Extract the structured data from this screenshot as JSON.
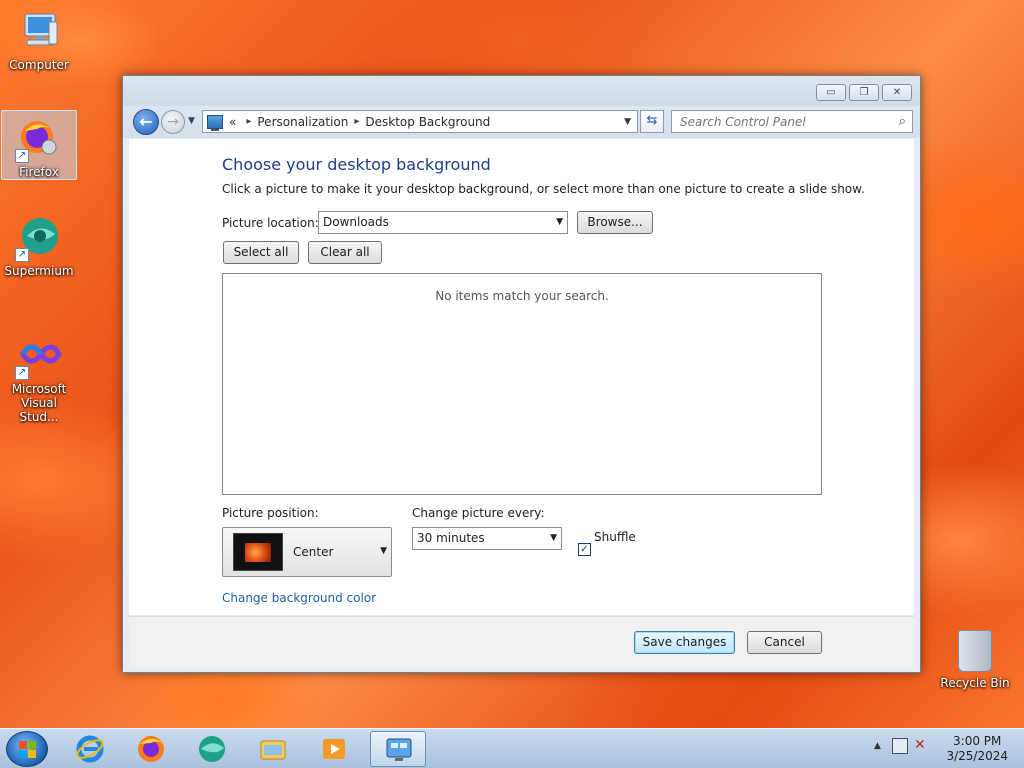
{
  "desktop": {
    "icons": [
      {
        "label": "Computer"
      },
      {
        "label": "Firefox"
      },
      {
        "label": "Supermium"
      },
      {
        "label": "Microsoft Visual Stud..."
      },
      {
        "label": "Recycle Bin"
      }
    ]
  },
  "window": {
    "controls": {
      "minimize": "▭",
      "maximize": "❐",
      "close": "✕"
    },
    "address": {
      "overflow": "«",
      "crumbs": [
        "Personalization",
        "Desktop Background"
      ],
      "separator": "▸"
    },
    "search": {
      "placeholder": "Search Control Panel"
    },
    "content": {
      "heading": "Choose your desktop background",
      "subtext": "Click a picture to make it your desktop background, or select more than one picture to create a slide show.",
      "picture_location_label": "Picture location:",
      "picture_location_value": "Downloads",
      "browse_label": "Browse...",
      "select_all_label": "Select all",
      "clear_all_label": "Clear all",
      "empty_message": "No items match your search.",
      "picture_position_label": "Picture position:",
      "picture_position_value": "Center",
      "change_every_label": "Change picture every:",
      "change_every_value": "30 minutes",
      "shuffle_label": "Shuffle",
      "shuffle_checked": true,
      "change_color_link": "Change background color"
    },
    "footer": {
      "save_label": "Save changes",
      "cancel_label": "Cancel"
    }
  },
  "taskbar": {
    "clock_time": "3:00 PM",
    "clock_date": "3/25/2024"
  },
  "colors": {
    "heading": "#1e3f87",
    "link": "#1d5ea8",
    "wallpaper": "#e9531a"
  }
}
